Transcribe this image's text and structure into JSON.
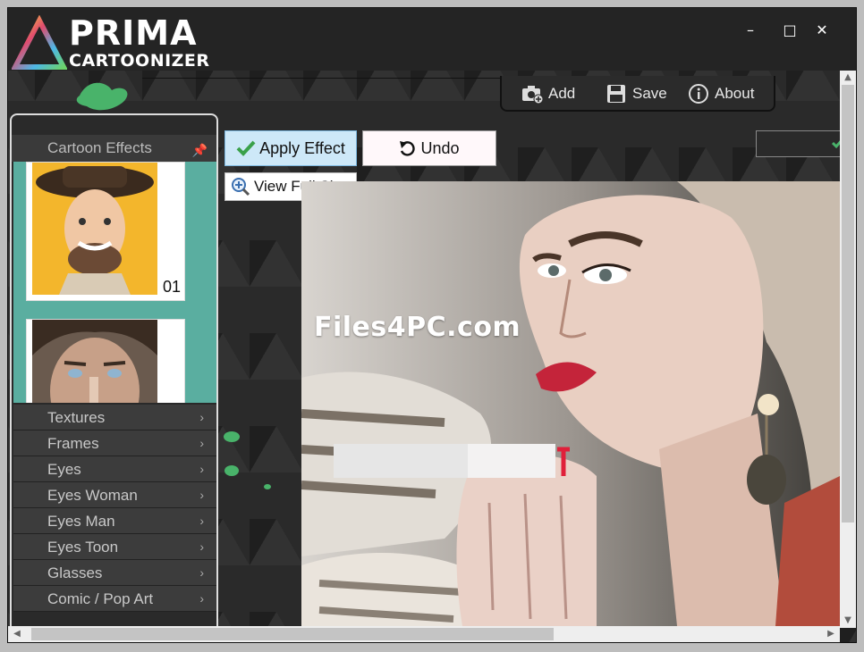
{
  "app": {
    "logo_line1": "PRIMA",
    "logo_line2": "CARTOONIZER"
  },
  "window_controls": {
    "minimize": "–",
    "maximize": "□",
    "close": "✕"
  },
  "toolbar": {
    "add_label": "Add",
    "save_label": "Save",
    "about_label": "About"
  },
  "panel": {
    "header": "Cartoon Effects",
    "thumbnails": [
      {
        "number": "01"
      },
      {
        "number": ""
      }
    ],
    "menu": [
      {
        "label": "Textures"
      },
      {
        "label": "Frames"
      },
      {
        "label": "Eyes"
      },
      {
        "label": "Eyes Woman"
      },
      {
        "label": "Eyes Man"
      },
      {
        "label": "Eyes Toon"
      },
      {
        "label": "Glasses"
      },
      {
        "label": "Comic / Pop Art"
      }
    ]
  },
  "actions": {
    "apply_label": "Apply Effect",
    "undo_label": "Undo",
    "view_full_label": "View Full Size"
  },
  "image": {
    "watermark": "Files4PC.com"
  },
  "colors": {
    "accent_green": "#49b36a",
    "panel_teal": "#5aaea0",
    "apply_bg": "#cde8f8"
  }
}
